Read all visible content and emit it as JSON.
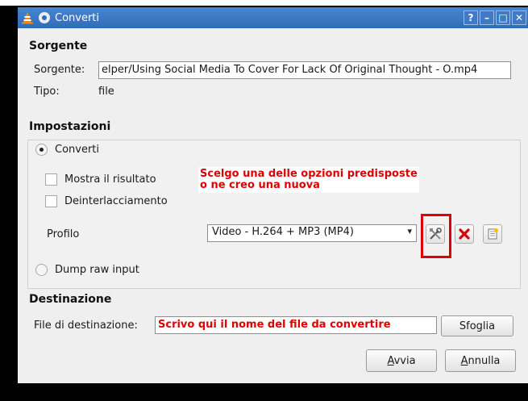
{
  "window": {
    "title": "Converti",
    "titlebar_buttons": [
      "?",
      "–",
      "□",
      "✕"
    ]
  },
  "source": {
    "section_title": "Sorgente",
    "source_label": "Sorgente:",
    "source_value": "elper/Using Social Media To Cover For Lack Of Original Thought - O.mp4",
    "type_label": "Tipo:",
    "type_value": "file"
  },
  "settings": {
    "section_title": "Impostazioni",
    "convert_label": "Converti",
    "show_output_label": "Mostra il risultato",
    "deinterlace_label": "Deinterlacciamento",
    "profile_label": "Profilo",
    "profile_selected": "Video - H.264 + MP3 (MP4)",
    "dump_raw_label": "Dump raw input",
    "annotation_line1": "Scelgo una delle opzioni predisposte",
    "annotation_line2": "o ne creo una nuova"
  },
  "destination": {
    "section_title": "Destinazione",
    "file_label": "File di destinazione:",
    "file_value": "Scrivo qui il nome del file da convertire",
    "browse_label": "Sfoglia"
  },
  "footer": {
    "start_label": "Avvia",
    "cancel_label": "Annulla"
  },
  "colors": {
    "titlebar": "#2f6bb8",
    "annotation": "#e00000",
    "window_bg": "#efefef"
  }
}
